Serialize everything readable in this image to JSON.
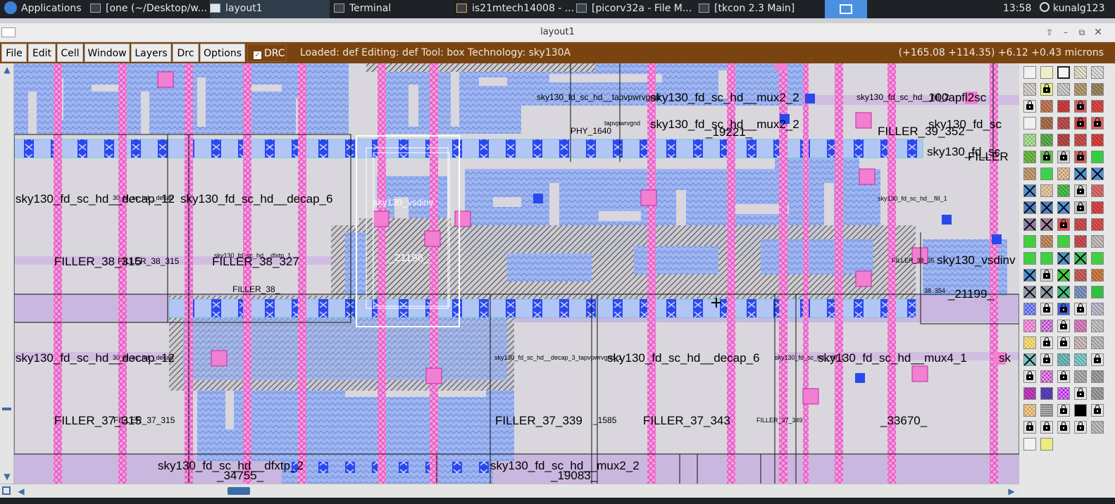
{
  "taskbar": {
    "applications": "Applications",
    "windows": [
      {
        "label": "[one (~/Desktop/w...",
        "icon": "editor-icon"
      },
      {
        "label": "layout1",
        "icon": "window-icon"
      },
      {
        "label": "Terminal",
        "icon": "terminal-icon"
      },
      {
        "label": "is21mtech14008 - ...",
        "icon": "home-icon"
      },
      {
        "label": "[picorv32a - File M...",
        "icon": "folder-icon"
      },
      {
        "label": "[tkcon 2.3 Main]",
        "icon": "window-icon"
      }
    ],
    "clock": "13:58",
    "user": "kunalg123"
  },
  "window": {
    "title": "layout1"
  },
  "menubar": {
    "items": [
      "File",
      "Edit",
      "Cell",
      "Window",
      "Layers",
      "Drc",
      "Options"
    ],
    "drc_toggle": "DRC",
    "status": "Loaded: def Editing: def Tool: box  Technology: sky130A",
    "coords": "(+165.08 +114.35) +6.12 +0.43 microns"
  },
  "labels": {
    "mux2_2_a": "sky130_fd_sc_hd__mux2_2",
    "tapvpwrvgnd_a": "sky130_fd_sc_hd__tapvpwrvgnd",
    "fill_a": "sky130_fd_sc_hd__fill_2",
    "apfl": "100apfl2sc",
    "phy": "PHY_1640",
    "tapvpwrvgnd_b": "tapvpwrvgnd",
    "mux2_2_b": "sky130_fd_sc_hd__mux2_2",
    "n19221": "_19221_",
    "filler_39_352": "FILLER_39_352",
    "sky_fd_sc_r1": "sky130_fd_sc",
    "sky_fd_sc_r2": "sky130_fd_sc",
    "filler_r": "FILLER",
    "decap_12_a": "sky130_fd_sc_hd__decap_12",
    "decap_12_a_over": "30_fd_sc_hd__decap",
    "decap_6_a": "sky130_fd_sc_hd__decap_6",
    "vsdinv": "sky130_vsdinv",
    "fill_1": "sky130_fd_sc_hd__fill_1",
    "filler_38_315": "FILLER_38_315",
    "filler_38_315_small": "FILLER_38_315",
    "filler_38_327": "FILLER_38_327",
    "dlxmark": "sky130_fd_sc_hd__dlxtp_1",
    "n21196": "_21196_",
    "filler_38_r": "FILLER_38_35",
    "vsdinv_r": "sky130_vsdinv",
    "filler_38_mid": "FILLER_38_",
    "n38_354": "38_354",
    "n21199": "_21199_",
    "decap_12_b": "sky130_fd_sc_hd__decap_12",
    "decap_12_b_over": "30_fd_sc_hd__decap",
    "mix_mid": "sky130_fd_sc_hd__decap_3_tapvpwrvgnd_1",
    "decap_6_b": "sky130_fd_sc_hd__decap_6",
    "fill_b": "sky130_fd_sc_hd__fill_1",
    "mux4_1": "sky130_fd_sc_hd__mux4_1",
    "sky_r3": "sk",
    "filler_37_315": "FILLER_37_315",
    "filler_37_small": "FILLER_37_315",
    "filler_37_339": "FILLER_37_339",
    "n1585": "_1585",
    "filler_37_343": "FILLER_37_343",
    "filler_37_349": "FILLER_37_349",
    "n33670": "_33670_",
    "dfxtp_2": "sky130_fd_sc_hd__dfxtp_2",
    "n34755": "_34755_",
    "mux2_2_c": "sky130_fd_sc_hd__mux2_2",
    "n19083": "_19083_"
  },
  "palette": {
    "rows": [
      [
        "#ececec|grid",
        "#efeec8|plain",
        "#f4f4f4|box",
        "#e8e4c8|stripe",
        "#e0e0e0|hatch"
      ],
      [
        "#d8d4d0|stripe",
        "#ecec80|lock",
        "#d0d0d0|hatch",
        "#b8a070|stripe",
        "#a08860|stripe"
      ],
      [
        "#e8e8e8|lock",
        "#c87a5a|hatch",
        "#d04040|hatch",
        "#d06060|lock",
        "#e04848|hatch"
      ],
      [
        "#f0f0f0|plain",
        "#b07050|hatch",
        "#c05050|hatch",
        "#d04040|lock",
        "#e06060|lock"
      ],
      [
        "#78c060|grid",
        "#60b050|hatch",
        "#c04848|hatch",
        "#d05050|hatch",
        "#e04040|hatch"
      ],
      [
        "#70c040|stripe",
        "#60c050|lock",
        "#d0d0d0|lock",
        "#d06060|lock",
        "#30d040|plain"
      ],
      [
        "#c8a070|hatch",
        "#40d050|plain",
        "#c89060|grid",
        "#5090d0|x",
        "#5090d0|x"
      ],
      [
        "#5090d0|x",
        "#c8a070|grid",
        "#50c050|hatch",
        "#d0d0d0|lock",
        "#e07070|hatch"
      ],
      [
        "#5080c0|x",
        "#5080c0|x",
        "#5090d0|x",
        "#c0c0c0|lock",
        "#e04848|hatch"
      ],
      [
        "#9080a0|x",
        "#a080a0|x",
        "#e05050|lock",
        "#d05050|hatch",
        "#e05050|hatch"
      ],
      [
        "#40d040|plain",
        "#c89060|hatch",
        "#40d040|plain",
        "#d05050|hatch",
        "#c8c0c0|hatch"
      ],
      [
        "#40d040|plain",
        "#40d040|plain",
        "#5090c0|x",
        "#40c060|x",
        "#40d040|plain"
      ],
      [
        "#5090d0|x",
        "#d0d0d0|lock",
        "#40d040|x",
        "#d06060|hatch",
        "#d08040|stripe"
      ],
      [
        "#9098a0|x",
        "#9098a0|x",
        "#40c080|x",
        "#8098c8|stripe",
        "#30c040|plain"
      ],
      [
        "#4050e0|grid",
        "#e0e0e0|lock",
        "#4060e0|lock",
        "#e0e0e0|lock",
        "#c0c0d0|stripe"
      ],
      [
        "#e060c0|grid",
        "#b040c0|grid",
        "#e0e0e0|lock",
        "#e080c0|hatch",
        "#c8c8c8|stripe"
      ],
      [
        "#e0c040|grid",
        "#e0e0e0|lock",
        "#e0e0e0|lock",
        "#d0c0c0|hatch",
        "#c0c0c0|hatch"
      ],
      [
        "#80c0c0|x",
        "#e0e0e0|lock",
        "#70c0c0|stripe",
        "#80d0d0|stripe",
        "#e0e0e0|lock"
      ],
      [
        "#e0e0e0|lock",
        "#c040c0|grid",
        "#e0e0e0|lock",
        "#b0b0b0|stripe",
        "#a0a0a0|stripe"
      ],
      [
        "#c040c0|stripe",
        "#6040c0|stripe",
        "#b020e0|grid",
        "#e0e0e0|lock",
        "#a0a0a0|stripe"
      ],
      [
        "#d0a050|grid",
        "#b0b0b0|hline",
        "#e0e0e0|lock",
        "#000000|plain",
        "#e0e0e0|lock"
      ],
      [
        "#e0e0e0|lock",
        "#e0e0e0|lock",
        "#e0e0e0|lock",
        "#e0e0e0|lock",
        "#c0c0c0|stripe"
      ],
      [
        "#eeeeee|grid",
        "#ecec80|plain"
      ]
    ]
  }
}
